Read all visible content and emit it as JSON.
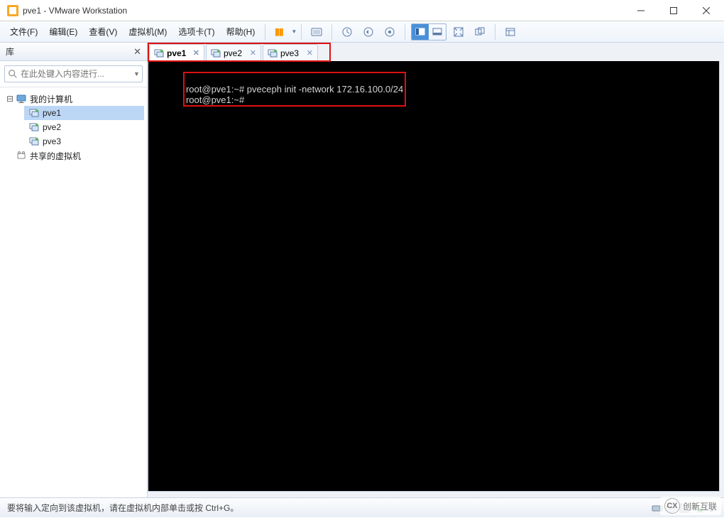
{
  "window": {
    "title": "pve1 - VMware Workstation"
  },
  "menu": {
    "file": "文件(F)",
    "edit": "编辑(E)",
    "view": "查看(V)",
    "vm": "虚拟机(M)",
    "tabs": "选项卡(T)",
    "help": "帮助(H)"
  },
  "sidebar": {
    "header": "库",
    "search_placeholder": "在此处键入内容进行...",
    "root": "我的计算机",
    "items": [
      "pve1",
      "pve2",
      "pve3"
    ],
    "shared": "共享的虚拟机"
  },
  "tabs": [
    {
      "name": "pve1",
      "active": true
    },
    {
      "name": "pve2",
      "active": false
    },
    {
      "name": "pve3",
      "active": false
    }
  ],
  "terminal": {
    "lines": [
      "root@pve1:~# pveceph init -network 172.16.100.0/24",
      "root@pve1:~# "
    ]
  },
  "status": {
    "text": "要将输入定向到该虚拟机，请在虚拟机内部单击或按 Ctrl+G。"
  },
  "watermark": {
    "text": "创新互联"
  }
}
